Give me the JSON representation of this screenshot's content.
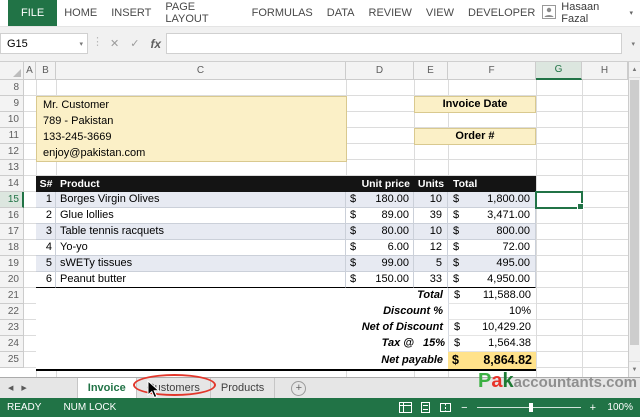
{
  "ribbon": {
    "file_label": "FILE",
    "tabs": [
      "HOME",
      "INSERT",
      "PAGE LAYOUT",
      "FORMULAS",
      "DATA",
      "REVIEW",
      "VIEW",
      "DEVELOPER"
    ],
    "user_name": "Hasaan Fazal"
  },
  "formula_bar": {
    "name_box": "G15",
    "formula": "",
    "cancel_icon": "✕",
    "enter_icon": "✓",
    "fx_icon": "fx",
    "caret_icon": "▾",
    "splitter_icon": "⋮"
  },
  "grid": {
    "column_letters": [
      "A",
      "B",
      "C",
      "D",
      "E",
      "F",
      "G",
      "H"
    ],
    "row_numbers": [
      "8",
      "9",
      "10",
      "11",
      "12",
      "13",
      "14",
      "15",
      "16",
      "17",
      "18",
      "19",
      "20",
      "21",
      "22",
      "23",
      "24",
      "25"
    ]
  },
  "customer": {
    "line1": "Mr. Customer",
    "line2": "789 - Pakistan",
    "line3": "133-245-3669",
    "line4": "enjoy@pakistan.com"
  },
  "meta": {
    "invoice_date_label": "Invoice Date",
    "order_label": "Order #"
  },
  "table": {
    "headers": {
      "sn": "S#",
      "product": "Product",
      "unit_price": "Unit price",
      "units": "Units",
      "total": "Total"
    },
    "rows": [
      {
        "sn": "1",
        "product": "Borges Virgin Olives",
        "cur": "$",
        "price": "180.00",
        "units": "10",
        "tcur": "$",
        "total": "1,800.00"
      },
      {
        "sn": "2",
        "product": "Glue lollies",
        "cur": "$",
        "price": "89.00",
        "units": "39",
        "tcur": "$",
        "total": "3,471.00"
      },
      {
        "sn": "3",
        "product": "Table tennis racquets",
        "cur": "$",
        "price": "80.00",
        "units": "10",
        "tcur": "$",
        "total": "800.00"
      },
      {
        "sn": "4",
        "product": "Yo-yo",
        "cur": "$",
        "price": "6.00",
        "units": "12",
        "tcur": "$",
        "total": "72.00"
      },
      {
        "sn": "5",
        "product": "sWETy tissues",
        "cur": "$",
        "price": "99.00",
        "units": "5",
        "tcur": "$",
        "total": "495.00"
      },
      {
        "sn": "6",
        "product": "Peanut butter",
        "cur": "$",
        "price": "150.00",
        "units": "33",
        "tcur": "$",
        "total": "4,950.00"
      }
    ],
    "summary": {
      "total_label": "Total",
      "total_cur": "$",
      "total_value": "11,588.00",
      "discount_label": "Discount %",
      "discount_value": "10%",
      "net_discount_label": "Net of Discount",
      "net_discount_cur": "$",
      "net_discount_value": "10,429.20",
      "tax_label": "Tax @",
      "tax_rate": "15%",
      "tax_cur": "$",
      "tax_value": "1,564.38",
      "net_payable_label": "Net payable",
      "net_payable_cur": "$",
      "net_payable_value": "8,864.82"
    }
  },
  "sheet_tabs": {
    "prev_icon": "◀",
    "next_icon": "▶",
    "tabs": [
      "Invoice",
      "Customers",
      "Products"
    ],
    "add_label": "+"
  },
  "status_bar": {
    "ready": "READY",
    "num_lock": "NUM LOCK",
    "zoom_out": "−",
    "zoom_in": "+",
    "zoom_level": "100%"
  },
  "scrollbar": {
    "up_icon": "▲",
    "down_icon": "▼"
  },
  "watermark": {
    "p": "P",
    "a": "a",
    "k": "k",
    "suffix": "accountants.com"
  },
  "colors": {
    "excel_green": "#217346",
    "highlight_yellow": "#FBF0C7",
    "net_payable_yellow": "#FFE28A",
    "band_blue": "#E7EAF2",
    "header_black": "#141414",
    "annotation_red": "#E2372B"
  }
}
